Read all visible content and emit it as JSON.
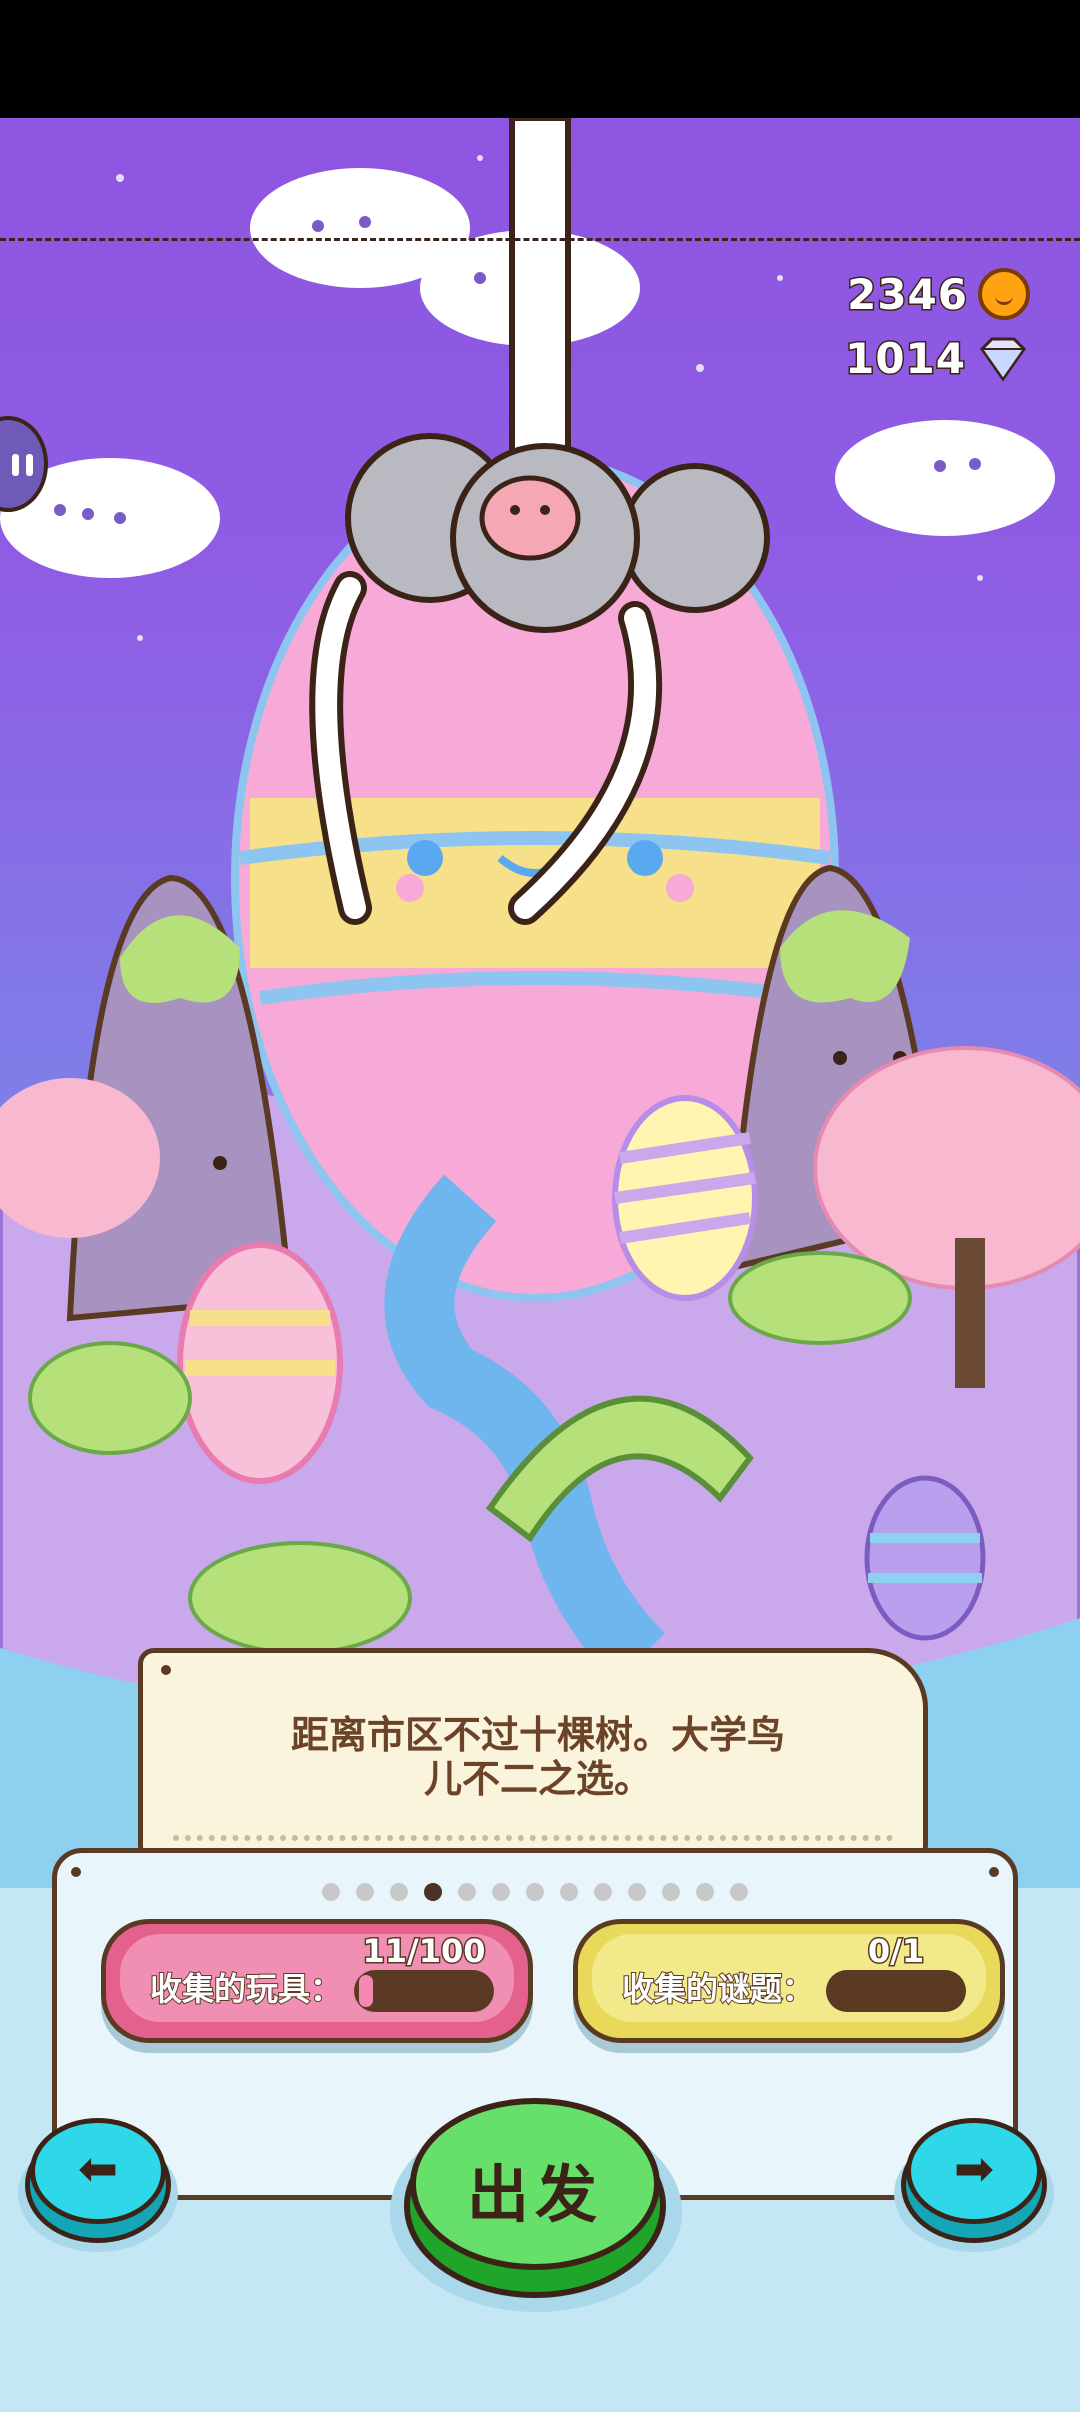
{
  "currency": {
    "coins": "2346",
    "gems": "1014",
    "coin_icon": "coin-icon",
    "gem_icon": "diamond-icon"
  },
  "level": {
    "description": "距离市区不过十棵树。大学鸟儿不二之选。",
    "description_line1": "距离市区不过十棵树。大学鸟",
    "description_line2": "儿不二之选。",
    "page_dots": 13,
    "active_page": 4
  },
  "stats": {
    "toys_label": "收集的玩具：",
    "toys_value": "11/100",
    "toys_progress": 0.11,
    "puzzles_label": "收集的谜题：",
    "puzzles_value": "0/1",
    "puzzles_progress": 0
  },
  "buttons": {
    "go_label": "出发",
    "prev_icon": "arrow-left-icon",
    "next_icon": "arrow-right-icon",
    "pause_icon": "pause-icon"
  },
  "colors": {
    "sky_top": "#8e55e0",
    "toy_pill": "#e4608d",
    "puzzle_pill": "#e8d95a",
    "go_button": "#66e06a",
    "arrow_button": "#2fd8e8"
  }
}
